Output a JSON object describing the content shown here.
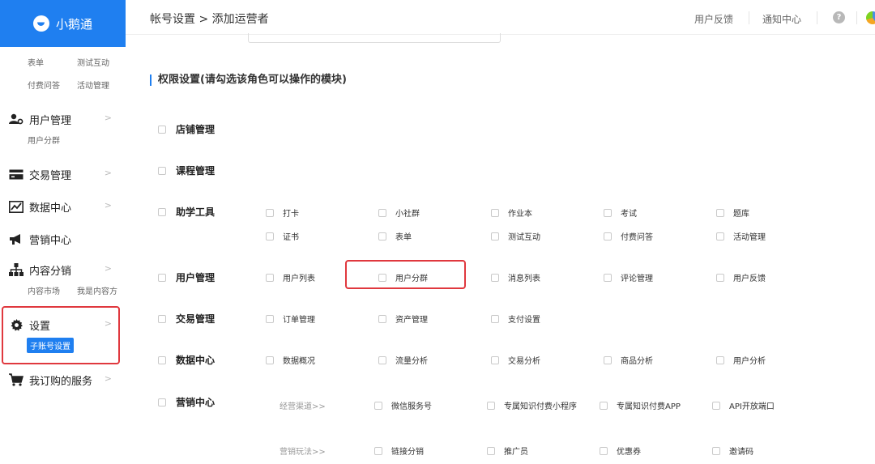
{
  "sidebar": {
    "logo_text": "小鹅通",
    "top_subs": [
      "表单",
      "测试互动",
      "付费问答",
      "活动管理"
    ],
    "items": [
      {
        "label": "用户管理",
        "icon": "user-gear-icon",
        "subs": [
          "用户分群"
        ]
      },
      {
        "label": "交易管理",
        "icon": "card-icon",
        "subs": []
      },
      {
        "label": "数据中心",
        "icon": "chart-icon",
        "subs": []
      },
      {
        "label": "营销中心",
        "icon": "megaphone-icon",
        "subs": []
      },
      {
        "label": "内容分销",
        "icon": "org-icon",
        "subs": [
          "内容市场",
          "我是内容方"
        ]
      },
      {
        "label": "设置",
        "icon": "gear-icon",
        "subs": [
          "子账号设置"
        ]
      },
      {
        "label": "我订购的服务",
        "icon": "cart-icon",
        "subs": []
      }
    ]
  },
  "header": {
    "breadcrumb": "帐号设置 > 添加运营者",
    "feedback": "用户反馈",
    "notifications": "通知中心"
  },
  "main": {
    "section_title": "权限设置(请勾选该角色可以操作的模块)",
    "groups": [
      {
        "label": "店铺管理",
        "options": []
      },
      {
        "label": "课程管理",
        "options": []
      },
      {
        "label": "助学工具",
        "options": [
          "打卡",
          "小社群",
          "作业本",
          "考试",
          "题库",
          "证书",
          "表单",
          "测试互动",
          "付费问答",
          "活动管理"
        ]
      },
      {
        "label": "用户管理",
        "options": [
          "用户列表",
          "用户分群",
          "消息列表",
          "评论管理",
          "用户反馈"
        ]
      },
      {
        "label": "交易管理",
        "options": [
          "订单管理",
          "资产管理",
          "支付设置"
        ]
      },
      {
        "label": "数据中心",
        "options": [
          "数据概况",
          "流量分析",
          "交易分析",
          "商品分析",
          "用户分析"
        ]
      },
      {
        "label": "营销中心",
        "channels": [
          {
            "label": "经营渠道>>",
            "options": [
              "微信服务号",
              "专属知识付费小程序",
              "专属知识付费APP",
              "API开放端口"
            ]
          },
          {
            "label": "营销玩法>>",
            "options": [
              "链接分销",
              "推广员",
              "优惠券",
              "邀请码"
            ]
          }
        ]
      }
    ]
  },
  "colors": {
    "brand": "#1f7ff0",
    "highlight": "#e0383e"
  }
}
